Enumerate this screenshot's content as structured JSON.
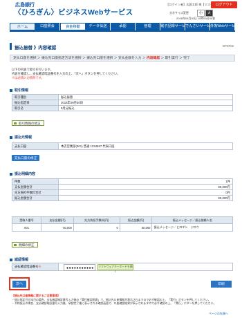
{
  "header": {
    "bank_name": "広島銀行",
    "service_name": "〈ひろぎん〉ビジネスWebサービス",
    "user_info": "【ログイン者】広銀太郎 様【マスターユーザ】",
    "logout": "ログアウト",
    "font_size_label": "文字サイズ変更",
    "font_small": "小",
    "font_large": "大",
    "datetime": "2016年09月30日 10時50分00秒"
  },
  "nav": {
    "tabs": [
      "ホーム",
      "口座照会",
      "資金移動",
      "データ伝送",
      "承認",
      "管理",
      "電子記録サービス",
      "でんさいサービス",
      "外為Webサービス"
    ]
  },
  "page": {
    "title": "振込振替 》内容確認",
    "screen_id": "BFKR02"
  },
  "steps": {
    "before": "支払口座を選択 ＞ 振込先口座指定方法を選択 ＞ 振込先口座を選択 ＞ 支払金額を入力 ＞ ",
    "current": "内容確認",
    "after": " ＞ 取引実行 ＞ 完了"
  },
  "intro": {
    "line1": "以下の内容で取引を行います。",
    "line2": "内容を確認し、支払確認暗証番号を入力の上、「次へ」ボタンを押してください。",
    "line3": "※は必須入力項目です。"
  },
  "sections": {
    "txn_info": "取引情報",
    "payer": "振込元情報",
    "detail": "振込明細内容",
    "auth": "認証情報"
  },
  "txn_info": {
    "rows": [
      {
        "k": "取引種別",
        "v": "振込振替"
      },
      {
        "k": "振込指定日",
        "v": "2016年09月30日"
      },
      {
        "k": "取引名",
        "v": "9月分振込"
      }
    ],
    "edit": "取引情報の修正"
  },
  "payer": {
    "rows": [
      {
        "k": "支払口座",
        "v": "本店営業部(001) 普通 1234567 代表口座"
      }
    ],
    "edit": "支払口座の修正"
  },
  "summary": {
    "rows": [
      {
        "k": "件数",
        "v": "1件"
      },
      {
        "k": "支払金額合計",
        "v": "50,000円"
      },
      {
        "k": "先方負担手数料合計",
        "v": "0円"
      },
      {
        "k": "振込金額合計",
        "v": "50,000円"
      }
    ]
  },
  "detail": {
    "headers": [
      "受取人番号",
      "支払金額(円)",
      "先方負担手数料(円)",
      "振込金額(円)",
      "振込メッセージ／振込依頼人名"
    ],
    "row": [
      "001",
      "50,000",
      "0",
      "50,000",
      "振込メッセージ／ヒロギン　ジロウ"
    ],
    "edit": "明細の修正"
  },
  "auth": {
    "label": "支払確認暗証番号",
    "required": "※",
    "dots": "●●●●●●●●●●●",
    "soft_kbd": "ソフトウェアキーボードを開く"
  },
  "buttons": {
    "next": "次へ",
    "print": "印刷"
  },
  "notes": {
    "title": "【振込先口座情報に関するご注意事項】",
    "line1": "・振込指定日が本日の場合、支払確認暗証番号入力後の「実行確認画面」で、振込先口座情報が表示されますので必ず確認の上、「実行」ボタンを押してください。",
    "line2": "・予約振込の場合、支払確認暗証番号入力後、承認完了後に表示される確認画面で、口座確認結果が表示されますので必ず確認の上、「実行」ボタンを押してください。"
  },
  "footer": {
    "page_top": "ページの先頭へ"
  },
  "colors": {
    "brand_blue": "#0c5aa6",
    "logout_red": "#e3301e",
    "button_blue": "#2b74c4"
  }
}
